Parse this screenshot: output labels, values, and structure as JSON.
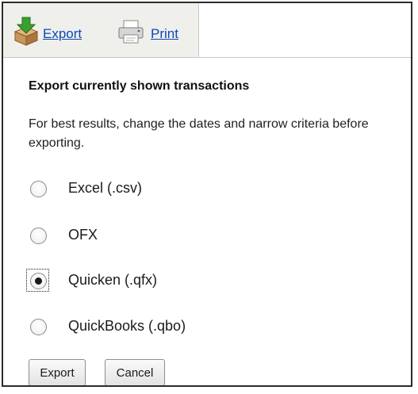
{
  "toolbar": {
    "export_label": "Export",
    "print_label": "Print"
  },
  "section": {
    "heading": "Export currently shown transactions",
    "hint": "For best results, change the dates and narrow criteria before exporting."
  },
  "options": [
    {
      "label": "Excel (.csv)",
      "checked": false
    },
    {
      "label": "OFX",
      "checked": false
    },
    {
      "label": "Quicken (.qfx)",
      "checked": true
    },
    {
      "label": "QuickBooks (.qbo)",
      "checked": false
    }
  ],
  "buttons": {
    "export_label": "Export",
    "cancel_label": "Cancel"
  },
  "colors": {
    "link": "#0b48b8",
    "tab_background": "#efefec",
    "export_icon_green": "#3aa12e",
    "export_icon_box": "#c8965a"
  },
  "icons": {
    "export": "box-with-down-arrow-icon",
    "print": "printer-icon"
  }
}
